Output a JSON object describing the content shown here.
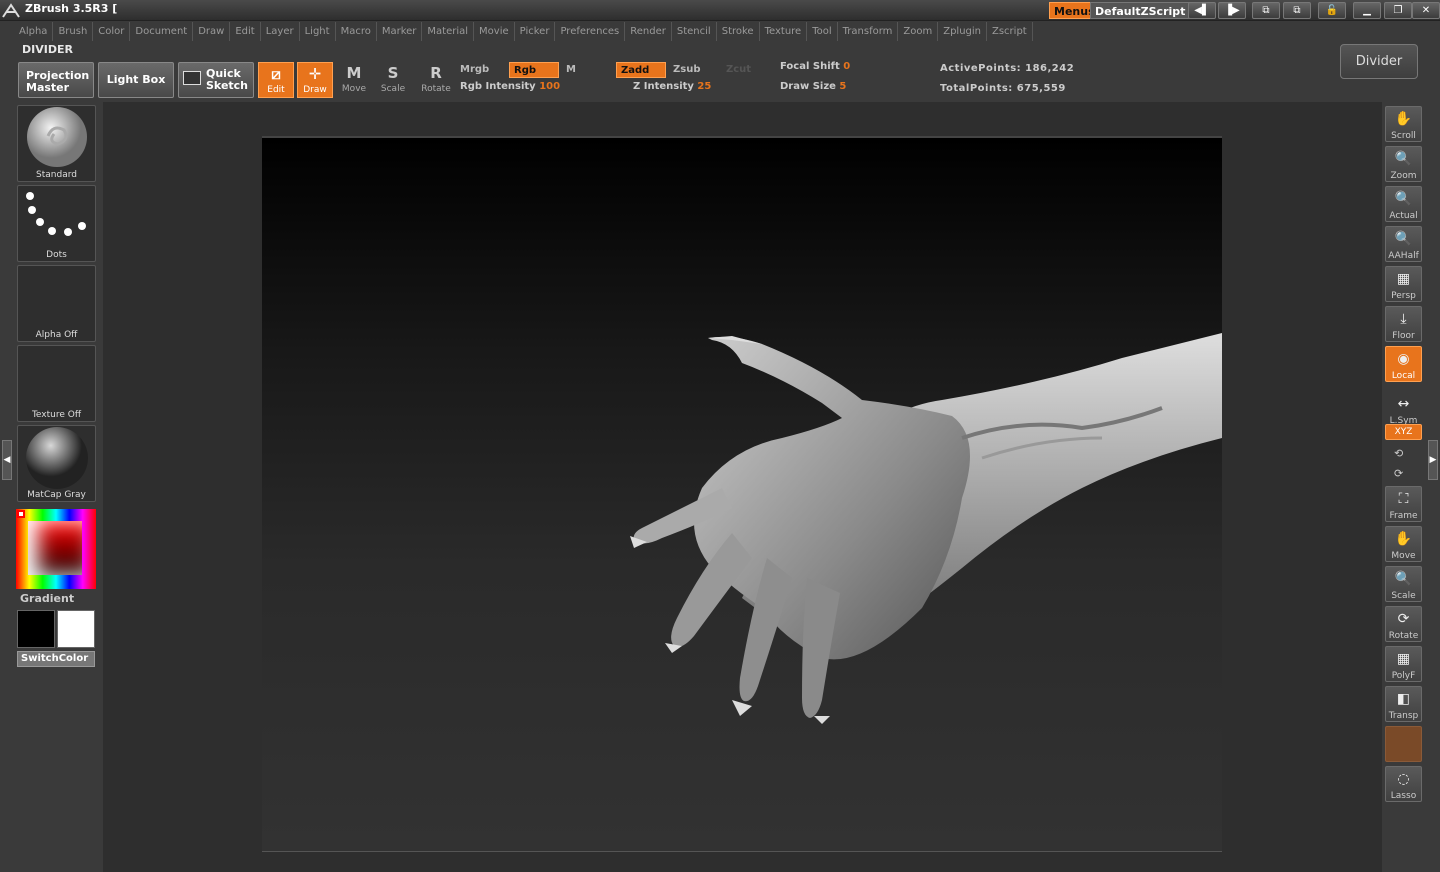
{
  "title": {
    "app": "ZBrush 3.5R3  [",
    "menus_label": "Menus",
    "script_label": "DefaultZScript"
  },
  "menus": [
    "Alpha",
    "Brush",
    "Color",
    "Document",
    "Draw",
    "Edit",
    "Layer",
    "Light",
    "Macro",
    "Marker",
    "Material",
    "Movie",
    "Picker",
    "Preferences",
    "Render",
    "Stencil",
    "Stroke",
    "Texture",
    "Tool",
    "Transform",
    "Zoom",
    "Zplugin",
    "Zscript"
  ],
  "palette_name": "DIVIDER",
  "divider_button": "Divider",
  "shelf": {
    "projection_master": "Projection Master",
    "light_box": "Light Box",
    "quick_sketch": "Quick Sketch",
    "tools": [
      {
        "label": "Edit",
        "active": true
      },
      {
        "label": "Draw",
        "active": true
      },
      {
        "label": "Move",
        "active": false
      },
      {
        "label": "Scale",
        "active": false
      },
      {
        "label": "Rotate",
        "active": false
      }
    ],
    "mrgb": "Mrgb",
    "rgb": "Rgb",
    "m": "M",
    "zadd": "Zadd",
    "zsub": "Zsub",
    "zcut": "Zcut",
    "rgb_intensity_label": "Rgb  Intensity",
    "rgb_intensity": "100",
    "z_intensity_label": "Z  Intensity",
    "z_intensity": "25",
    "focal_shift_label": "Focal  Shift",
    "focal_shift": "0",
    "draw_size_label": "Draw  Size",
    "draw_size": "5",
    "active_points": "ActivePoints: 186,242",
    "total_points": "TotalPoints: 675,559"
  },
  "left": {
    "brush": "Standard",
    "stroke": "Dots",
    "alpha": "Alpha  Off",
    "texture": "Texture  Off",
    "material": "MatCap  Gray",
    "gradient": "Gradient",
    "switch_color": "SwitchColor"
  },
  "right": [
    {
      "label": "Scroll",
      "icon": "hand-icon"
    },
    {
      "label": "Zoom",
      "icon": "magnifier-icon"
    },
    {
      "label": "Actual",
      "icon": "actual-icon"
    },
    {
      "label": "AAHalf",
      "icon": "aahalf-icon"
    },
    {
      "label": "Persp",
      "icon": "grid-icon"
    },
    {
      "label": "Floor",
      "icon": "floor-icon"
    },
    {
      "label": "Local",
      "icon": "local-icon"
    },
    {
      "label": "L.Sym",
      "icon": "sym-icon"
    },
    {
      "label": "XYZ",
      "icon": "xyz-icon"
    },
    {
      "label": "Frame",
      "icon": "frame-icon"
    },
    {
      "label": "Move",
      "icon": "move-icon"
    },
    {
      "label": "Scale",
      "icon": "scale-icon"
    },
    {
      "label": "Rotate",
      "icon": "rotate-icon"
    },
    {
      "label": "PolyF",
      "icon": "polyframe-icon"
    },
    {
      "label": "Transp",
      "icon": "transp-icon"
    },
    {
      "label": "Lasso",
      "icon": "lasso-icon"
    }
  ],
  "colors": {
    "accent": "#e8741c",
    "panel": "#3a3a3a",
    "canvas": "#2e2e2e"
  }
}
